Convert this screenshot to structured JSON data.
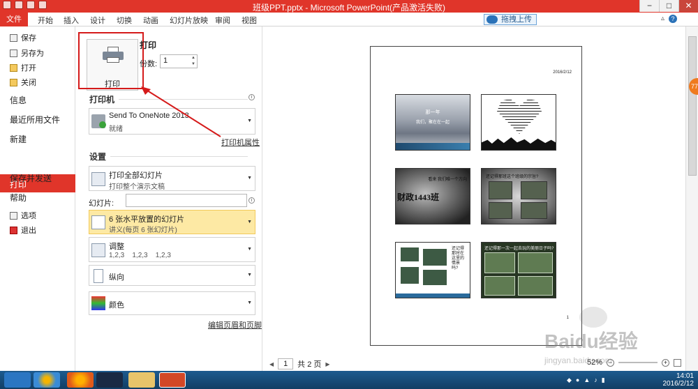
{
  "window": {
    "title": "班级PPT.pptx - Microsoft PowerPoint(产品激活失败)",
    "controls": [
      "−",
      "□",
      "✕"
    ]
  },
  "ribbon": {
    "file_tab": "文件",
    "tabs": [
      "开始",
      "插入",
      "设计",
      "切换",
      "动画",
      "幻灯片放映",
      "审阅",
      "视图"
    ],
    "upload": "拖拽上传"
  },
  "nav": {
    "small_items": [
      "保存",
      "另存为",
      "打开",
      "关闭"
    ],
    "big_items": [
      "信息",
      "最近所用文件",
      "新建"
    ],
    "active": "打印",
    "more_items": [
      "保存并发送",
      "帮助"
    ],
    "bottom_items": [
      "选项",
      "退出"
    ]
  },
  "print": {
    "button_label": "打印",
    "heading": "打印",
    "copies_label": "份数:",
    "copies_value": "1"
  },
  "printer": {
    "heading": "打印机",
    "name": "Send To OneNote 2013",
    "status": "就绪",
    "properties_link": "打印机属性"
  },
  "settings": {
    "heading": "设置",
    "range_title": "打印全部幻灯片",
    "range_sub": "打印整个演示文稿",
    "slides_label": "幻灯片:",
    "slides_value": "",
    "layout_title": "6 张水平放置的幻灯片",
    "layout_sub": "讲义(每页 6 张幻灯片)",
    "collate_title": "调整",
    "collate_sub": "1,2,3    1,2,3    1,2,3",
    "orientation": "纵向",
    "color": "颜色",
    "header_footer_link": "编辑页眉和页脚"
  },
  "preview": {
    "date": "2016/2/12",
    "page_number": "1",
    "current_page": "1",
    "total_pages": "共 2 页",
    "zoom": "52%",
    "slide1_line1": "那一年",
    "slide1_line2": "我们，聚在在一起",
    "slide3_big": "财政1443班",
    "slide3_small": "看来 我们唯一个方向",
    "slide4_caption": "还记得那班这个班级的宗旨?",
    "slide5_text": "还记得那时在这里的情景吗?",
    "slide6_caption": "还记得那一次一起去玩的美丽日子吗?"
  },
  "taskbar": {
    "time": "14:01",
    "date": "2016/2/12"
  },
  "watermark": {
    "line1": "Baidu经验",
    "line2": "jingyan.baidu.com"
  },
  "badge": "77"
}
